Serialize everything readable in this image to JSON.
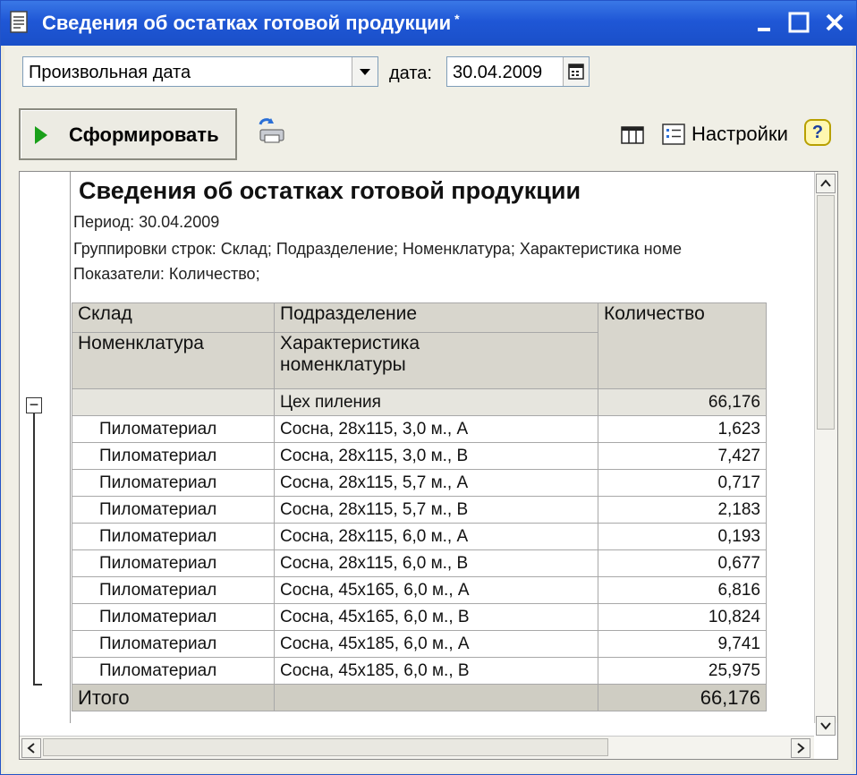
{
  "window": {
    "title": "Сведения об остатках готовой продукции",
    "modified_mark": "*"
  },
  "filter": {
    "period_mode": "Произвольная дата",
    "date_label": "дата:",
    "date_value": "30.04.2009"
  },
  "toolbar": {
    "generate_label": "Сформировать",
    "settings_label": "Настройки",
    "help_label": "?"
  },
  "report": {
    "title": "Сведения об остатках готовой продукции",
    "period": "Период: 30.04.2009",
    "groupings": "Группировки строк: Склад; Подразделение; Номенклатура; Характеристика номе",
    "indicators": "Показатели: Количество;",
    "columns": {
      "warehouse": "Склад",
      "department": "Подразделение",
      "quantity": "Количество",
      "nomenclature": "Номенклатура",
      "characteristic": "Характеристика номенклатуры"
    },
    "group": {
      "department": "Цех пиления",
      "quantity": "66,176",
      "collapse_symbol": "−"
    },
    "rows": [
      {
        "item": "Пиломатериал",
        "characteristic": "Сосна, 28х115, 3,0 м., А",
        "quantity": "1,623"
      },
      {
        "item": "Пиломатериал",
        "characteristic": "Сосна, 28х115, 3,0 м., В",
        "quantity": "7,427"
      },
      {
        "item": "Пиломатериал",
        "characteristic": "Сосна, 28х115, 5,7 м., А",
        "quantity": "0,717"
      },
      {
        "item": "Пиломатериал",
        "characteristic": "Сосна, 28х115, 5,7 м., В",
        "quantity": "2,183"
      },
      {
        "item": "Пиломатериал",
        "characteristic": "Сосна, 28х115, 6,0 м., А",
        "quantity": "0,193"
      },
      {
        "item": "Пиломатериал",
        "characteristic": "Сосна, 28х115, 6,0 м., В",
        "quantity": "0,677"
      },
      {
        "item": "Пиломатериал",
        "characteristic": "Сосна, 45х165, 6,0 м., А",
        "quantity": "6,816"
      },
      {
        "item": "Пиломатериал",
        "characteristic": "Сосна, 45х165, 6,0 м., В",
        "quantity": "10,824"
      },
      {
        "item": "Пиломатериал",
        "characteristic": "Сосна, 45х185, 6,0 м., А",
        "quantity": "9,741"
      },
      {
        "item": "Пиломатериал",
        "characteristic": "Сосна, 45х185, 6,0 м., В",
        "quantity": "25,975"
      }
    ],
    "total": {
      "label": "Итого",
      "quantity": "66,176"
    }
  },
  "icons": {
    "app": "report-document-icon",
    "minimize": "minimize-icon",
    "maximize": "maximize-icon",
    "close": "close-icon",
    "dropdown": "chevron-down-icon",
    "calendar": "calendar-icon",
    "generate": "play-icon",
    "refresh": "print-refresh-icon",
    "layout": "table-layout-icon",
    "settings": "settings-list-icon",
    "help": "help-icon"
  },
  "colors": {
    "titlebar": "#1f57d6",
    "header_bg": "#d8d6cd",
    "play": "#1aa01a"
  }
}
